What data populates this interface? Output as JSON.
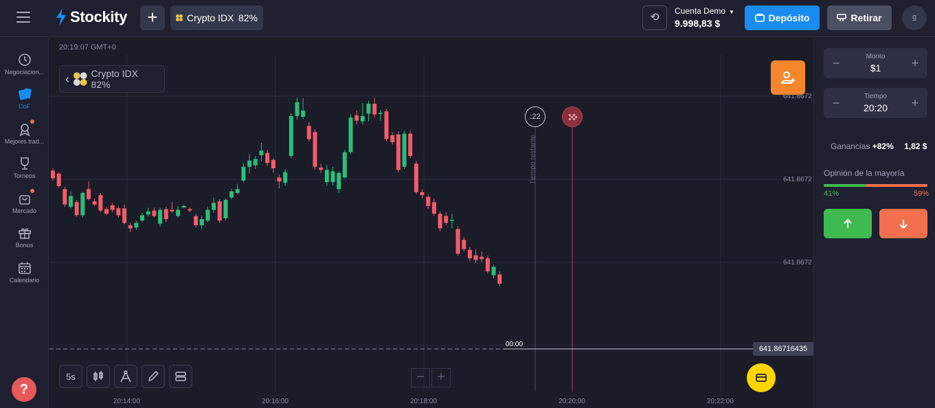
{
  "header": {
    "brand": "Stockity",
    "asset_tab": {
      "name": "Crypto IDX",
      "payout": "82%"
    },
    "account": {
      "name": "Cuenta Demo",
      "balance": "9.998,83 $"
    },
    "deposit_label": "Depósito",
    "withdraw_label": "Retirar",
    "avatar_initial": "g",
    "colors": {
      "deposit": "#1a8cf0",
      "withdraw": "#4b4f62"
    }
  },
  "sidebar": {
    "items": [
      {
        "label": "Negociacion...",
        "icon": "clock-icon"
      },
      {
        "label": "CoF",
        "icon": "cards-icon",
        "active": true
      },
      {
        "label": "Mejores trad...",
        "icon": "award-icon",
        "notification": true
      },
      {
        "label": "Torneos",
        "icon": "trophy-icon"
      },
      {
        "label": "Mercado",
        "icon": "bag-icon",
        "notification": true
      },
      {
        "label": "Bonos",
        "icon": "gift-icon"
      },
      {
        "label": "Calendario",
        "icon": "calendar-icon"
      }
    ],
    "help_label": "?"
  },
  "chart": {
    "clock": "20:19:07 GMT+0",
    "asset_chip": "Crypto IDX 82%",
    "timeframe": "5s",
    "timer": ":22",
    "remaining_label": "Tiempo restante",
    "current_price": "641.86716435",
    "current_time_label": "00:00",
    "y_labels": [
      "641.8672",
      "641.8672",
      "641.8672"
    ],
    "x_labels": [
      "20:14:00",
      "20:16:00",
      "20:18:00",
      "20:20:00",
      "20:22:00"
    ],
    "colors": {
      "up": "#2dbd7b",
      "down": "#f25c6a",
      "deadline": "#b84050"
    }
  },
  "trade": {
    "amount_caption": "Monto",
    "amount": "$1",
    "time_caption": "Tiempo",
    "time": "20:20",
    "earnings_label": "Ganancias",
    "earnings_pct": "+82%",
    "earnings_amount": "1,82 $",
    "opinion_label": "Opinión de la mayoría",
    "opinion_up": "41%",
    "opinion_down": "59%",
    "opinion_up_fraction": 0.41,
    "colors": {
      "up": "#3fba50",
      "down": "#f2704d"
    }
  },
  "chart_data": {
    "type": "candlestick",
    "candles": [
      {
        "o": 3.0,
        "c": 2.0,
        "h": 3.3,
        "l": 1.7
      },
      {
        "o": 2.6,
        "c": 1.0,
        "h": 2.8,
        "l": 0.8
      },
      {
        "o": 0.6,
        "c": -1.4,
        "h": 0.9,
        "l": -1.7
      },
      {
        "o": -1.7,
        "c": -0.3,
        "h": 0.3,
        "l": -1.9
      },
      {
        "o": -1.1,
        "c": -2.8,
        "h": -0.8,
        "l": -3.0
      },
      {
        "o": -2.8,
        "c": 0.1,
        "h": 0.3,
        "l": -3.1
      },
      {
        "o": 0.6,
        "c": -0.7,
        "h": 1.6,
        "l": -0.9
      },
      {
        "o": -1.0,
        "c": -1.4,
        "h": -0.6,
        "l": -1.6
      },
      {
        "o": -0.2,
        "c": -2.2,
        "h": 0.1,
        "l": -2.4
      },
      {
        "o": -2.0,
        "c": -2.6,
        "h": -1.7,
        "l": -2.8
      },
      {
        "o": -1.5,
        "c": -2.1,
        "h": -1.2,
        "l": -2.4
      },
      {
        "o": -1.9,
        "c": -2.8,
        "h": -1.6,
        "l": -3.1
      },
      {
        "o": -1.9,
        "c": -3.8,
        "h": -1.4,
        "l": -4.0
      },
      {
        "o": -4.1,
        "c": -4.5,
        "h": -3.8,
        "l": -5.0
      },
      {
        "o": -4.4,
        "c": -3.8,
        "h": -3.5,
        "l": -4.7
      },
      {
        "o": -3.5,
        "c": -2.8,
        "h": -2.5,
        "l": -3.7
      },
      {
        "o": -2.7,
        "c": -2.3,
        "h": -1.8,
        "l": -3.0
      },
      {
        "o": -2.2,
        "c": -2.9,
        "h": -1.8,
        "l": -3.1
      },
      {
        "o": -3.9,
        "c": -2.1,
        "h": -1.8,
        "l": -4.3
      },
      {
        "o": -2.0,
        "c": -3.3,
        "h": -1.7,
        "l": -3.7
      },
      {
        "o": -2.1,
        "c": -2.3,
        "h": -1.1,
        "l": -2.5
      },
      {
        "o": -2.9,
        "c": -2.1,
        "h": -1.6,
        "l": -3.1
      },
      {
        "o": -1.8,
        "c": -1.6,
        "h": -1.4,
        "l": -1.9
      },
      {
        "o": -2.0,
        "c": -2.2,
        "h": -1.8,
        "l": -2.4
      },
      {
        "o": -2.9,
        "c": -4.1,
        "h": -2.6,
        "l": -4.4
      },
      {
        "o": -4.1,
        "c": -3.3,
        "h": -2.8,
        "l": -4.6
      },
      {
        "o": -3.5,
        "c": -2.1,
        "h": -1.7,
        "l": -3.7
      },
      {
        "o": -2.1,
        "c": -1.2,
        "h": -0.5,
        "l": -2.5
      },
      {
        "o": -1.0,
        "c": -3.5,
        "h": -0.7,
        "l": -3.8
      },
      {
        "o": -3.2,
        "c": -0.8,
        "h": -0.6,
        "l": -3.5
      },
      {
        "o": -0.5,
        "c": 0.3,
        "h": 0.6,
        "l": -0.7
      },
      {
        "o": 0.1,
        "c": 0.6,
        "h": 1.3,
        "l": -0.1
      },
      {
        "o": 1.7,
        "c": 3.5,
        "h": 4.0,
        "l": 1.5
      },
      {
        "o": 3.5,
        "c": 4.3,
        "h": 5.2,
        "l": 2.6
      },
      {
        "o": 3.7,
        "c": 4.5,
        "h": 4.9,
        "l": 3.2
      },
      {
        "o": 5.0,
        "c": 5.6,
        "h": 6.6,
        "l": 4.2
      },
      {
        "o": 5.3,
        "c": 4.0,
        "h": 5.7,
        "l": 3.6
      },
      {
        "o": 4.4,
        "c": 3.3,
        "h": 4.6,
        "l": 2.7
      },
      {
        "o": 2.1,
        "c": 1.6,
        "h": 2.5,
        "l": 0.7
      },
      {
        "o": 1.4,
        "c": 2.8,
        "h": 3.2,
        "l": 1.0
      },
      {
        "o": 4.9,
        "c": 10.1,
        "h": 10.5,
        "l": 4.6
      },
      {
        "o": 10.1,
        "c": 11.9,
        "h": 12.5,
        "l": 9.6
      },
      {
        "o": 10.0,
        "c": 10.8,
        "h": 12.4,
        "l": 9.7
      },
      {
        "o": 8.8,
        "c": 7.1,
        "h": 9.3,
        "l": 6.8
      },
      {
        "o": 8.0,
        "c": 3.5,
        "h": 8.4,
        "l": 3.1
      },
      {
        "o": 3.4,
        "c": 3.1,
        "h": 3.9,
        "l": 2.7
      },
      {
        "o": 1.5,
        "c": 3.1,
        "h": 3.7,
        "l": 1.0
      },
      {
        "o": 1.5,
        "c": 2.9,
        "h": 3.5,
        "l": 1.1
      },
      {
        "o": 0.6,
        "c": 2.7,
        "h": 2.9,
        "l": 0.1
      },
      {
        "o": 2.1,
        "c": 5.4,
        "h": 5.7,
        "l": 2.0
      },
      {
        "o": 5.4,
        "c": 9.9,
        "h": 10.3,
        "l": 5.1
      },
      {
        "o": 10.2,
        "c": 9.5,
        "h": 10.8,
        "l": 9.0
      },
      {
        "o": 9.4,
        "c": 10.1,
        "h": 11.8,
        "l": 9.0
      },
      {
        "o": 10.4,
        "c": 11.7,
        "h": 12.1,
        "l": 9.4
      },
      {
        "o": 11.7,
        "c": 10.3,
        "h": 12.5,
        "l": 9.9
      },
      {
        "o": 10.4,
        "c": 10.5,
        "h": 10.9,
        "l": 9.5
      },
      {
        "o": 10.7,
        "c": 7.1,
        "h": 11.0,
        "l": 6.8
      },
      {
        "o": 7.6,
        "c": 6.7,
        "h": 8.0,
        "l": 6.4
      },
      {
        "o": 7.7,
        "c": 3.1,
        "h": 8.1,
        "l": 2.8
      },
      {
        "o": 3.5,
        "c": 7.8,
        "h": 8.2,
        "l": 3.2
      },
      {
        "o": 7.8,
        "c": 4.9,
        "h": 8.2,
        "l": 4.6
      },
      {
        "o": 3.9,
        "c": 0.2,
        "h": 4.3,
        "l": -0.1
      },
      {
        "o": 0.2,
        "c": -0.2,
        "h": 0.6,
        "l": -0.6
      },
      {
        "o": -0.4,
        "c": -1.6,
        "h": -0.1,
        "l": -2.0
      },
      {
        "o": -1.1,
        "c": -2.6,
        "h": -0.6,
        "l": -2.9
      },
      {
        "o": -2.6,
        "c": -4.5,
        "h": -2.3,
        "l": -4.9
      },
      {
        "o": -2.9,
        "c": -3.8,
        "h": -2.4,
        "l": -4.1
      },
      {
        "o": -3.5,
        "c": -3.4,
        "h": -2.6,
        "l": -4.5
      },
      {
        "o": -4.6,
        "c": -7.8,
        "h": -4.2,
        "l": -8.1
      },
      {
        "o": -6.0,
        "c": -7.2,
        "h": -5.6,
        "l": -7.5
      },
      {
        "o": -7.3,
        "c": -8.4,
        "h": -6.9,
        "l": -8.8
      },
      {
        "o": -8.0,
        "c": -8.6,
        "h": -7.2,
        "l": -9.0
      },
      {
        "o": -8.2,
        "c": -8.5,
        "h": -7.5,
        "l": -8.9
      },
      {
        "o": -8.4,
        "c": -10.1,
        "h": -8.0,
        "l": -10.4
      },
      {
        "o": -10.6,
        "c": -9.5,
        "h": -9.2,
        "l": -11.0
      },
      {
        "o": -10.5,
        "c": -11.7,
        "h": -10.1,
        "l": -12.0
      }
    ]
  }
}
